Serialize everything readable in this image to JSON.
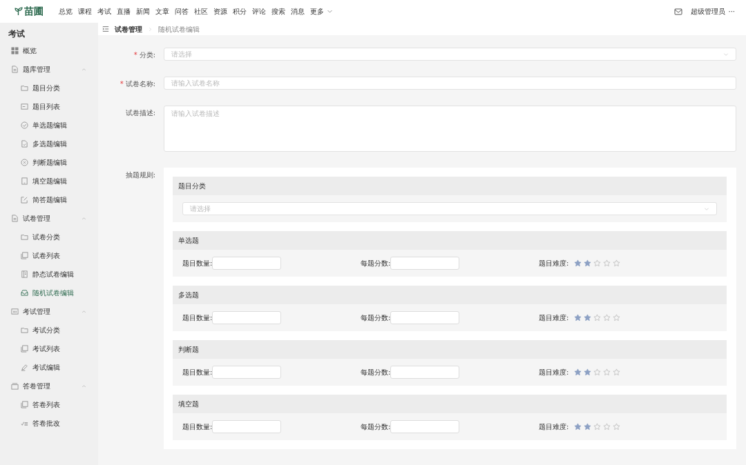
{
  "topbar": {
    "logo": "苗圃",
    "nav": [
      "总览",
      "课程",
      "考试",
      "直播",
      "新闻",
      "文章",
      "问答",
      "社区",
      "资源",
      "积分",
      "评论",
      "搜索",
      "消息"
    ],
    "more": "更多",
    "user": "超级管理员",
    "user_menu": "···"
  },
  "sidebar": {
    "title": "考试",
    "items": [
      {
        "label": "概览",
        "selected": false
      },
      {
        "label": "题库管理",
        "expanded": true,
        "children": [
          {
            "label": "题目分类",
            "selected": false
          },
          {
            "label": "题目列表",
            "selected": false
          },
          {
            "label": "单选题编辑",
            "selected": false
          },
          {
            "label": "多选题编辑",
            "selected": false
          },
          {
            "label": "判断题编辑",
            "selected": false
          },
          {
            "label": "填空题编辑",
            "selected": false
          },
          {
            "label": "简答题编辑",
            "selected": false
          }
        ]
      },
      {
        "label": "试卷管理",
        "expanded": true,
        "children": [
          {
            "label": "试卷分类",
            "selected": false
          },
          {
            "label": "试卷列表",
            "selected": false
          },
          {
            "label": "静态试卷编辑",
            "selected": false
          },
          {
            "label": "随机试卷编辑",
            "selected": true
          }
        ]
      },
      {
        "label": "考试管理",
        "expanded": true,
        "children": [
          {
            "label": "考试分类",
            "selected": false
          },
          {
            "label": "考试列表",
            "selected": false
          },
          {
            "label": "考试编辑",
            "selected": false
          }
        ]
      },
      {
        "label": "答卷管理",
        "expanded": true,
        "children": [
          {
            "label": "答卷列表",
            "selected": false
          },
          {
            "label": "答卷批改",
            "selected": false
          }
        ]
      }
    ]
  },
  "breadcrumb": [
    "试卷管理",
    "随机试卷编辑"
  ],
  "form": {
    "required_mark": "*",
    "fields": [
      {
        "kind": "select",
        "label": "分类:",
        "required": true,
        "placeholder": "请选择"
      },
      {
        "kind": "input",
        "label": "试卷名称:",
        "required": true,
        "placeholder": "请输入试卷名称"
      },
      {
        "kind": "textarea",
        "label": "试卷描述:",
        "required": false,
        "placeholder": "请输入试卷描述"
      }
    ],
    "rules": {
      "label": "抽题规则:",
      "category": {
        "title": "题目分类",
        "placeholder": "请选择"
      },
      "types": [
        {
          "title": "单选题",
          "count_label": "题目数量:",
          "score_label": "每题分数:",
          "difficulty_label": "题目难度:",
          "stars": 2
        },
        {
          "title": "多选题",
          "count_label": "题目数量:",
          "score_label": "每题分数:",
          "difficulty_label": "题目难度:",
          "stars": 2
        },
        {
          "title": "判断题",
          "count_label": "题目数量:",
          "score_label": "每题分数:",
          "difficulty_label": "题目难度:",
          "stars": 2
        },
        {
          "title": "填空题",
          "count_label": "题目数量:",
          "score_label": "每题分数:",
          "difficulty_label": "题目难度:",
          "stars": 2
        }
      ]
    }
  }
}
